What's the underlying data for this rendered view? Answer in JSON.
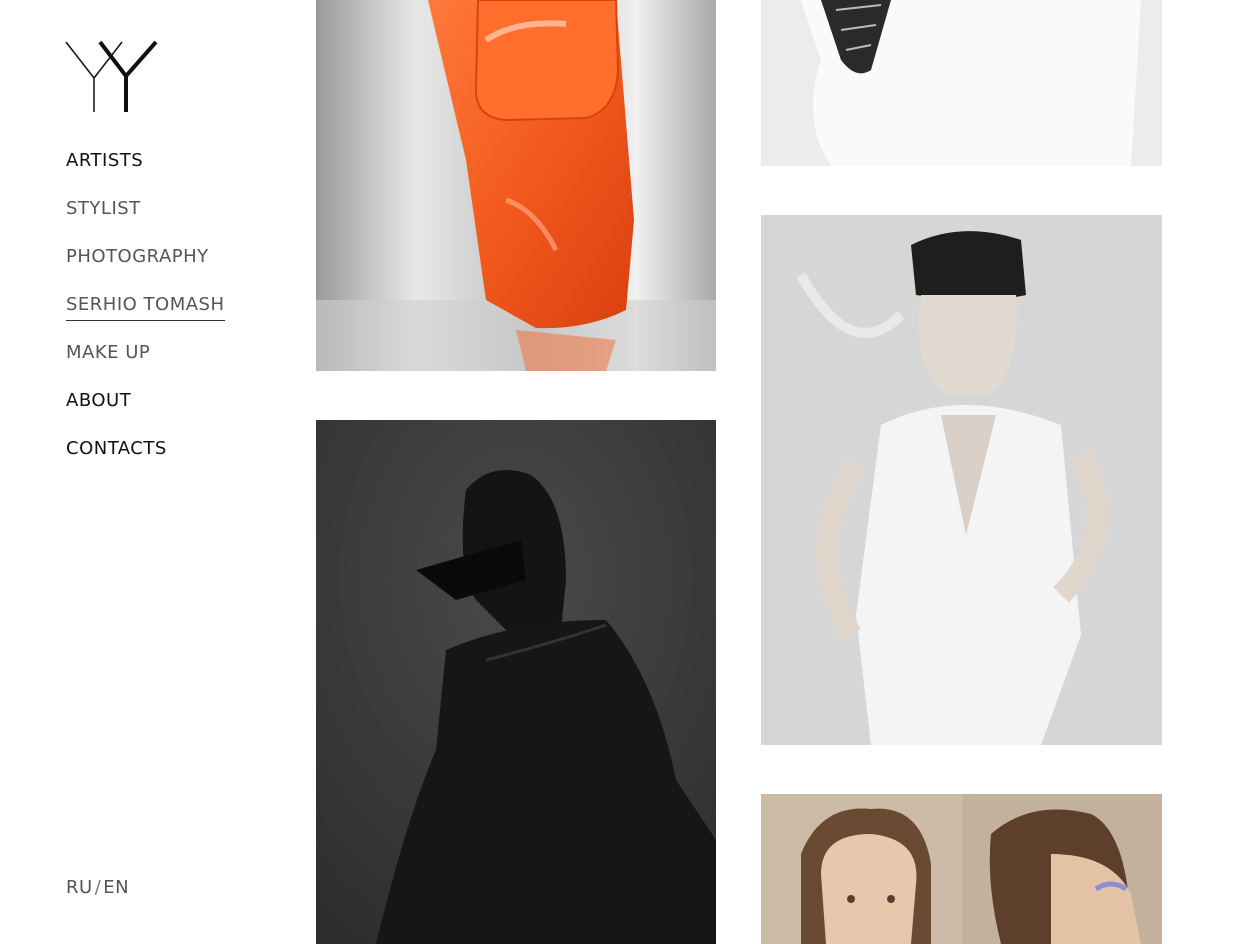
{
  "brand": {
    "logo_icon": "yy-monogram-logo"
  },
  "nav": {
    "items": [
      {
        "label": "ARTISTS",
        "style": "dark"
      },
      {
        "label": "STYLIST",
        "style": "muted"
      },
      {
        "label": "PHOTOGRAPHY",
        "style": "muted"
      },
      {
        "label": "SERHIO TOMASH",
        "style": "muted",
        "active": true
      },
      {
        "label": "MAKE UP",
        "style": "muted"
      },
      {
        "label": "ABOUT",
        "style": "dark"
      },
      {
        "label": "CONTACTS",
        "style": "dark"
      }
    ]
  },
  "lang": {
    "ru": "RU",
    "separator": "/",
    "en": "EN"
  },
  "gallery": {
    "images": [
      {
        "subject": "orange-patent-shoe",
        "accent": "#f25a1e"
      },
      {
        "subject": "dark-portrait-sunglasses",
        "accent": "#3a3a3a"
      },
      {
        "subject": "white-dress-cropped",
        "accent": "#e6e6e6"
      },
      {
        "subject": "white-vest-portrait",
        "accent": "#d9d9d9"
      },
      {
        "subject": "two-faces-makeup",
        "accent": "#c8b8a4"
      }
    ]
  }
}
